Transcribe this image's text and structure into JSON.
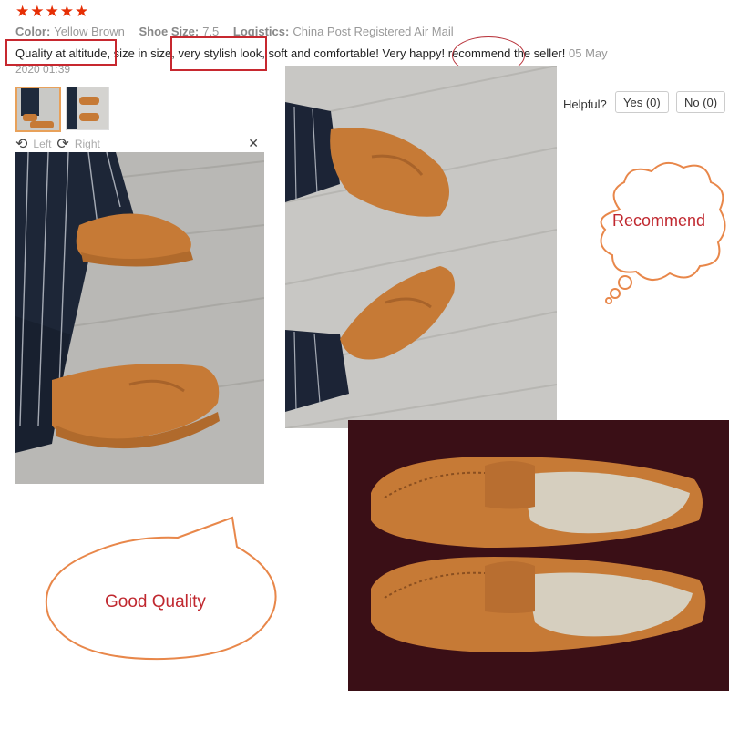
{
  "review": {
    "stars": "★★★★★",
    "color_label": "Color:",
    "color_value": "Yellow Brown",
    "size_label": "Shoe Size:",
    "size_value": "7.5",
    "logistics_label": "Logistics:",
    "logistics_value": "China Post Registered Air Mail",
    "part1": "Quality at altitude,",
    "part2": " size in size, ",
    "part3": "very stylish look,",
    "part4": " soft and comfortable! Very happy! ",
    "part5": "recommend",
    "part6": " the seller!",
    "date_line1": "05 May",
    "date_line2": "2020 01:39"
  },
  "viewer": {
    "left_label": "Left",
    "right_label": "Right"
  },
  "helpful": {
    "label": "Helpful?",
    "yes": "Yes (0)",
    "no": "No (0)"
  },
  "callouts": {
    "recommend": "Recommend",
    "good_quality": "Good Quality"
  },
  "colors": {
    "star": "#e62e04",
    "highlight": "#c7282f",
    "bubble": "#e8874a",
    "shoe": "#c67a36"
  }
}
